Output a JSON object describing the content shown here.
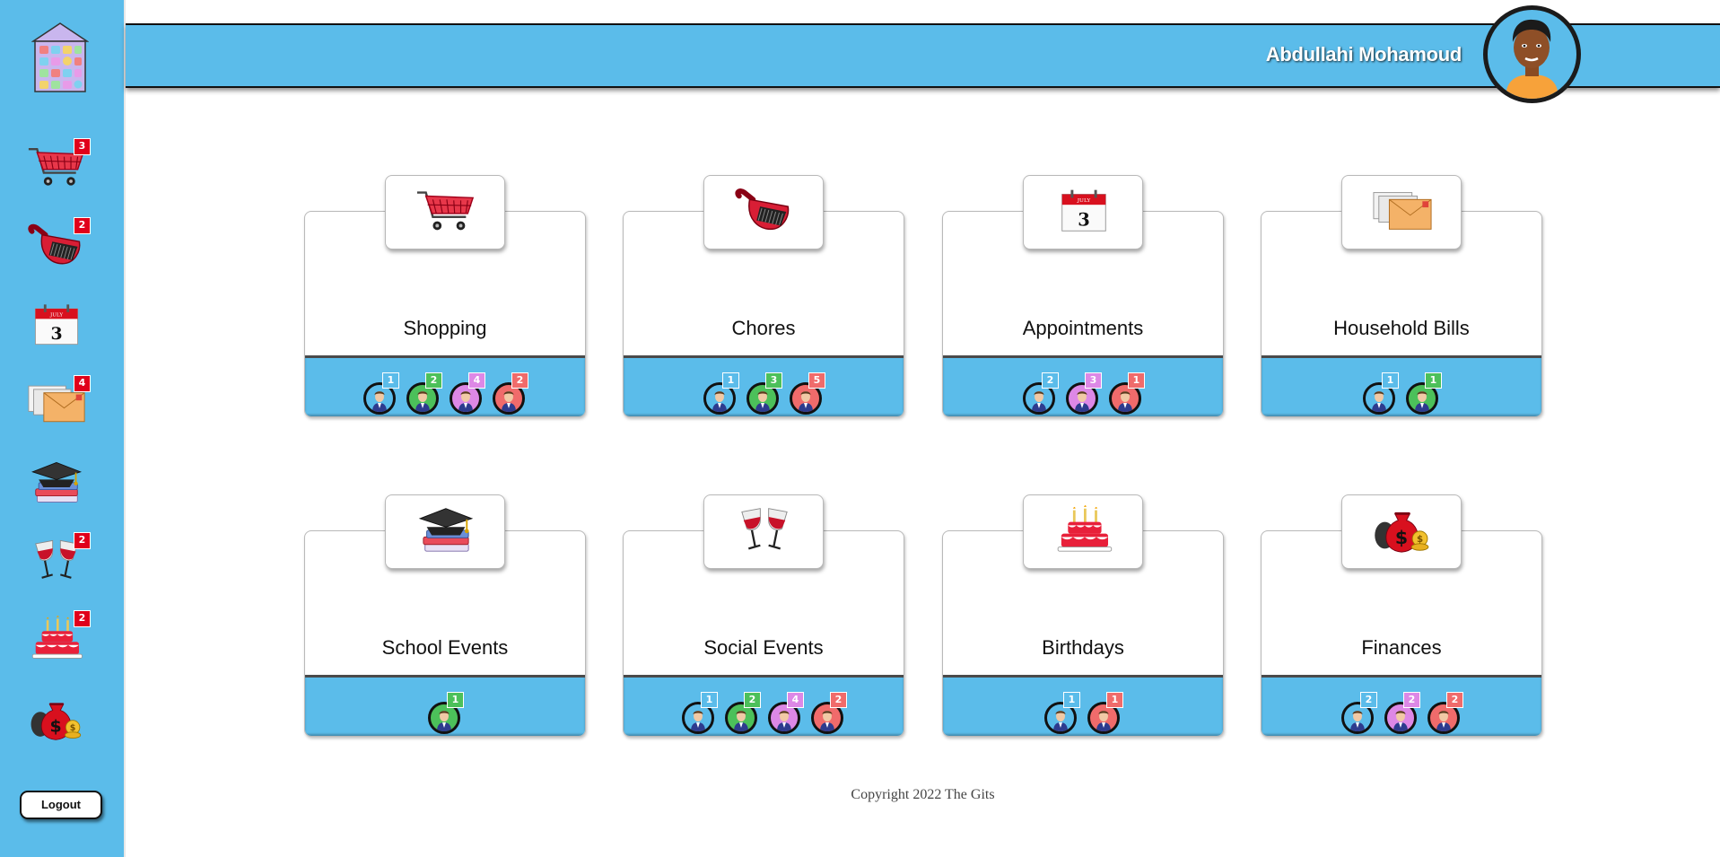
{
  "header": {
    "user_name": "Abdullahi Mohamoud"
  },
  "sidebar": {
    "items": [
      {
        "name": "shopping",
        "icon": "shopping-cart-icon",
        "badge": "3"
      },
      {
        "name": "chores",
        "icon": "dustpan-icon",
        "badge": "2"
      },
      {
        "name": "appointments",
        "icon": "calendar-icon",
        "badge": ""
      },
      {
        "name": "household-bills",
        "icon": "envelopes-icon",
        "badge": "4"
      },
      {
        "name": "school-events",
        "icon": "graduation-cap-books-icon",
        "badge": ""
      },
      {
        "name": "social-events",
        "icon": "wine-glasses-icon",
        "badge": "2"
      },
      {
        "name": "birthdays",
        "icon": "birthday-cake-icon",
        "badge": "2"
      },
      {
        "name": "finances",
        "icon": "money-bag-icon",
        "badge": ""
      }
    ],
    "logout_label": "Logout"
  },
  "calendar_icon": {
    "month": "JULY",
    "day": "3"
  },
  "member_colors": {
    "blue": "#5bbcea",
    "green": "#4cc05a",
    "purple": "#dd88e6",
    "red": "#f06b6b"
  },
  "cards": [
    {
      "title": "Shopping",
      "icon": "shopping-cart-icon",
      "members": [
        {
          "color": "blue",
          "count": "1"
        },
        {
          "color": "green",
          "count": "2"
        },
        {
          "color": "purple",
          "count": "4"
        },
        {
          "color": "red",
          "count": "2"
        }
      ]
    },
    {
      "title": "Chores",
      "icon": "dustpan-icon",
      "members": [
        {
          "color": "blue",
          "count": "1"
        },
        {
          "color": "green",
          "count": "3"
        },
        {
          "color": "red",
          "count": "5"
        }
      ]
    },
    {
      "title": "Appointments",
      "icon": "calendar-icon",
      "members": [
        {
          "color": "blue",
          "count": "2"
        },
        {
          "color": "purple",
          "count": "3"
        },
        {
          "color": "red",
          "count": "1"
        }
      ]
    },
    {
      "title": "Household Bills",
      "icon": "envelopes-icon",
      "members": [
        {
          "color": "blue",
          "count": "1"
        },
        {
          "color": "green",
          "count": "1"
        }
      ]
    },
    {
      "title": "School Events",
      "icon": "graduation-cap-books-icon",
      "members": [
        {
          "color": "green",
          "count": "1"
        }
      ]
    },
    {
      "title": "Social Events",
      "icon": "wine-glasses-icon",
      "members": [
        {
          "color": "blue",
          "count": "1"
        },
        {
          "color": "green",
          "count": "2"
        },
        {
          "color": "purple",
          "count": "4"
        },
        {
          "color": "red",
          "count": "2"
        }
      ]
    },
    {
      "title": "Birthdays",
      "icon": "birthday-cake-icon",
      "members": [
        {
          "color": "blue",
          "count": "1"
        },
        {
          "color": "red",
          "count": "1"
        }
      ]
    },
    {
      "title": "Finances",
      "icon": "money-bag-icon",
      "members": [
        {
          "color": "blue",
          "count": "2"
        },
        {
          "color": "purple",
          "count": "2"
        },
        {
          "color": "red",
          "count": "2"
        }
      ]
    }
  ],
  "footer": {
    "copyright": "Copyright 2022 The Gits"
  }
}
